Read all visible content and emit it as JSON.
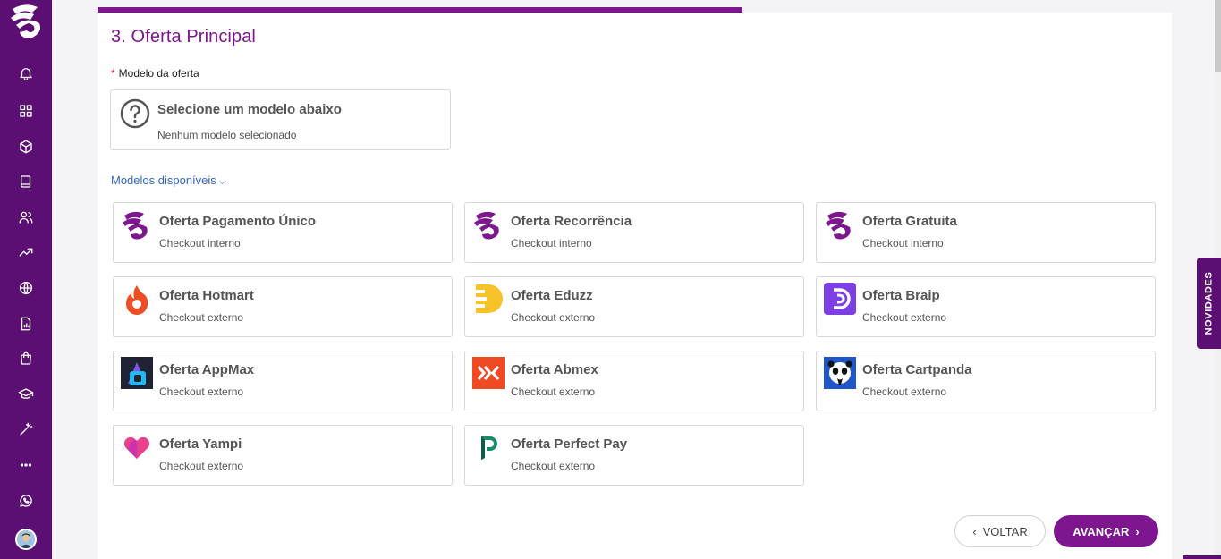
{
  "sidebar": {
    "items": [
      {
        "icon": "bell-icon"
      },
      {
        "icon": "dashboard-grid-icon"
      },
      {
        "icon": "box-icon"
      },
      {
        "icon": "book-icon"
      },
      {
        "icon": "users-icon"
      },
      {
        "icon": "trending-up-icon"
      },
      {
        "icon": "globe-icon"
      },
      {
        "icon": "report-file-icon"
      },
      {
        "icon": "shopping-bag-icon"
      },
      {
        "icon": "graduation-cap-icon"
      },
      {
        "icon": "magic-wand-icon"
      },
      {
        "icon": "more-dots-icon"
      },
      {
        "icon": "whatsapp-icon"
      }
    ]
  },
  "progress": {
    "fraction": 0.6
  },
  "step": {
    "title": "3. Oferta Principal"
  },
  "field": {
    "required_mark": "*",
    "label": "Modelo da oferta"
  },
  "selected": {
    "title": "Selecione um modelo abaixo",
    "subtitle": "Nenhum modelo selecionado"
  },
  "models_toggle": {
    "label": "Modelos disponíveis"
  },
  "models": [
    {
      "title": "Oferta Pagamento Único",
      "subtitle": "Checkout interno",
      "logo": "brand-logo"
    },
    {
      "title": "Oferta Recorrência",
      "subtitle": "Checkout interno",
      "logo": "brand-logo"
    },
    {
      "title": "Oferta Gratuita",
      "subtitle": "Checkout interno",
      "logo": "brand-logo"
    },
    {
      "title": "Oferta Hotmart",
      "subtitle": "Checkout externo",
      "logo": "hotmart-logo"
    },
    {
      "title": "Oferta Eduzz",
      "subtitle": "Checkout externo",
      "logo": "eduzz-logo"
    },
    {
      "title": "Oferta Braip",
      "subtitle": "Checkout externo",
      "logo": "braip-logo"
    },
    {
      "title": "Oferta AppMax",
      "subtitle": "Checkout externo",
      "logo": "appmax-logo"
    },
    {
      "title": "Oferta Abmex",
      "subtitle": "Checkout externo",
      "logo": "abmex-logo"
    },
    {
      "title": "Oferta Cartpanda",
      "subtitle": "Checkout externo",
      "logo": "cartpanda-logo"
    },
    {
      "title": "Oferta Yampi",
      "subtitle": "Checkout externo",
      "logo": "yampi-logo"
    },
    {
      "title": "Oferta Perfect Pay",
      "subtitle": "Checkout externo",
      "logo": "perfectpay-logo"
    }
  ],
  "buttons": {
    "back": "VOLTAR",
    "next": "AVANÇAR"
  },
  "novidades": {
    "label": "NOVIDADES"
  },
  "colors": {
    "brand": "#7e168f",
    "sidebar": "#5b0f73",
    "link": "#3466c8"
  }
}
